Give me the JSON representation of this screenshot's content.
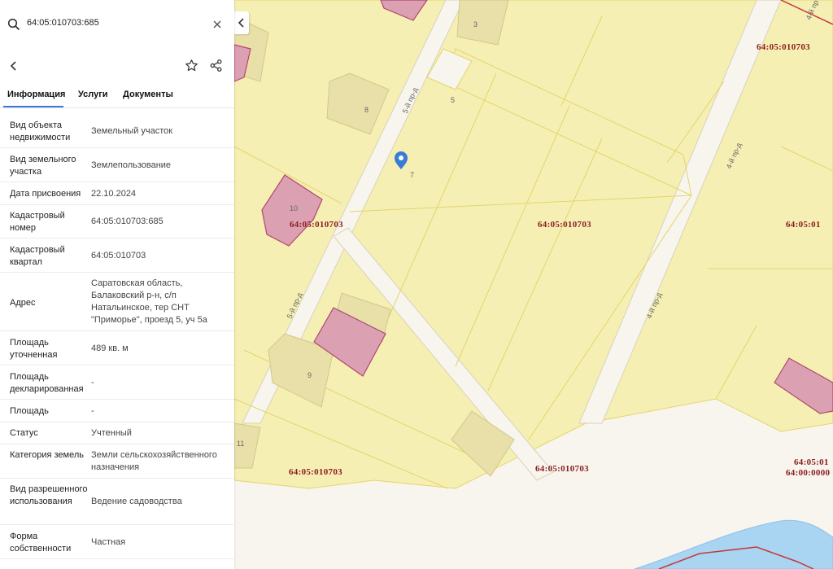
{
  "search": {
    "value": "64:05:010703:685"
  },
  "tabs": [
    "Информация",
    "Услуги",
    "Документы"
  ],
  "rows": [
    {
      "label": "Вид объекта недвижимости",
      "value": "Земельный участок"
    },
    {
      "label": "Вид земельного участка",
      "value": "Землепользование"
    },
    {
      "label": "Дата присвоения",
      "value": "22.10.2024"
    },
    {
      "label": "Кадастровый номер",
      "value": "64:05:010703:685"
    },
    {
      "label": "Кадастровый квартал",
      "value": "64:05:010703"
    },
    {
      "label": "Адрес",
      "value": "Саратовская область, Балаковский р-н, с/п Натальинское, тер СНТ \"Приморье\", проезд 5, уч 5а"
    },
    {
      "label": "Площадь уточненная",
      "value": "489 кв. м"
    },
    {
      "label": "Площадь декларированная",
      "value": "-"
    },
    {
      "label": "Площадь",
      "value": "-"
    },
    {
      "label": "Статус",
      "value": "Учтенный"
    },
    {
      "label": "Категория земель",
      "value": "Земли сельскохозяйственного назначения"
    },
    {
      "label": "Вид разрешенного использования",
      "value": "Ведение садоводства"
    },
    {
      "label": "Форма собственности",
      "value": "Частная"
    }
  ],
  "map": {
    "quarter_labels": {
      "q1": "64:05:010703",
      "q2": "64:05:010703",
      "q3": "64:05:010703",
      "q4": "64:05:010703",
      "q5": "64:05:010703",
      "q6": "64:05:010703",
      "q7": "64:05:01",
      "q8": "64:05:01",
      "q9": "64:00:0000"
    },
    "road_labels": {
      "road5a": "5-й пр-д",
      "road5b": "5-й пр-д",
      "road4a": "4-й пр-д",
      "road4b": "4-й пр-д",
      "road4c": "4-й пр"
    },
    "parcel_numbers": {
      "p3": "3",
      "p5": "5",
      "p7": "7",
      "p8": "8",
      "p9": "9",
      "p10": "10",
      "p11": "11"
    },
    "colors": {
      "parcel_fill": "#f6efb4",
      "parcel_stroke": "#e3d56a",
      "building_fill": "#e8e0a8",
      "registered_building": "#dba1b3",
      "water": "#a9d4f2",
      "marker": "#3a7bd5",
      "quarter_text": "#8b1c1c"
    }
  }
}
